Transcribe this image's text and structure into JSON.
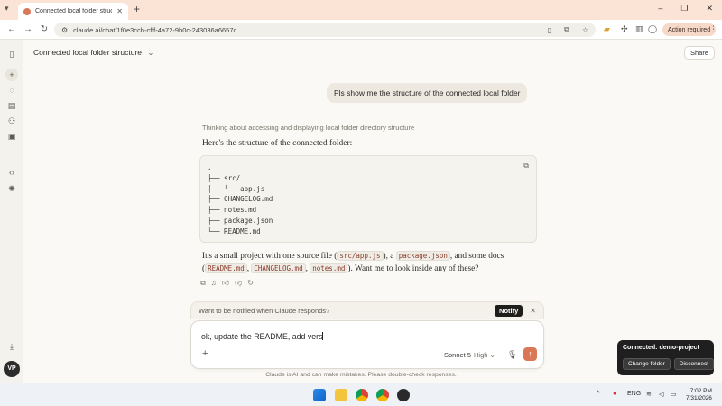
{
  "browser": {
    "tab_title": "Connected local folder structu",
    "url": "claude.ai/chat/1f0e3ccb-cfff-4a72-9b0c-243036a6657c",
    "action_required": "Action required"
  },
  "header": {
    "title": "Connected local folder structure",
    "share": "Share"
  },
  "user_message": "Pls show me the structure of the connected local folder",
  "assistant": {
    "thinking": "Thinking about accessing and displaying local folder directory structure",
    "intro": "Here's the structure of the connected folder:",
    "code_lines": [
      ".",
      "├── src/",
      "│   └── app.js",
      "├── CHANGELOG.md",
      "├── notes.md",
      "├── package.json",
      "└── README.md"
    ],
    "para": {
      "t1": "It's a small project with one source file (",
      "c1": "src/app.js",
      "t2": "), a ",
      "c2": "package.json",
      "t3": ", and some docs (",
      "c3": "README.md",
      "t4": ", ",
      "c4": "CHANGELOG.md",
      "t5": ", ",
      "c5": "notes.md",
      "t6": "). Want me to look inside any of these?"
    }
  },
  "notify": {
    "text": "Want to be notified when Claude responds?",
    "button": "Notify"
  },
  "composer": {
    "text": "ok, update the README, add vers",
    "model": "Sonnet 5",
    "effort": "High ⌄"
  },
  "disclaimer": "Claude is AI and can make mistakes. Please double-check responses.",
  "connection": {
    "title": "Connected: demo-project",
    "change": "Change folder",
    "disconnect": "Disconnect"
  },
  "avatar": "VP",
  "taskbar": {
    "lang": "ENG",
    "time": "7:02 PM",
    "date": "7/31/2026"
  },
  "colors": {
    "accent": "#d97757",
    "tabbar": "#fbe3d6"
  }
}
